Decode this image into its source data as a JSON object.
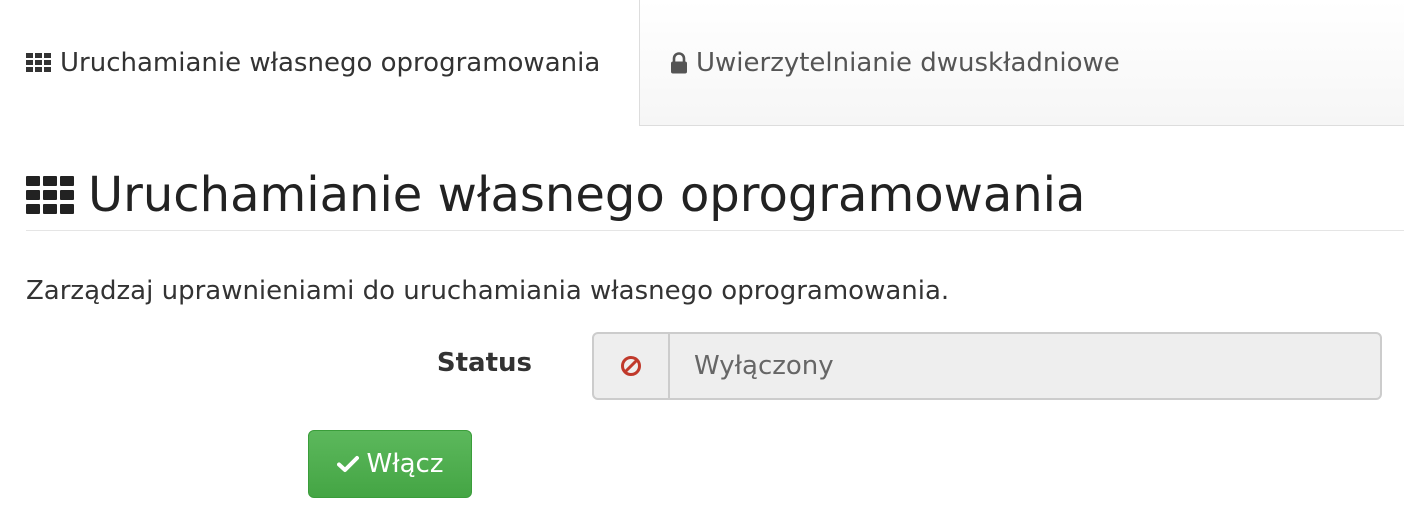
{
  "tabs": [
    {
      "label": "Uruchamianie własnego oprogramowania",
      "icon": "grid-icon",
      "active": true
    },
    {
      "label": "Uwierzytelnianie dwuskładniowe",
      "icon": "lock-icon",
      "active": false
    }
  ],
  "page": {
    "title": "Uruchamianie własnego oprogramowania",
    "title_icon": "grid-icon",
    "description": "Zarządzaj uprawnieniami do uruchamiania własnego oprogramowania."
  },
  "status": {
    "label": "Status",
    "value": "Wyłączony",
    "icon": "ban-icon",
    "icon_color": "#c0392b"
  },
  "actions": {
    "enable_label": "Włącz",
    "enable_icon": "check-icon",
    "enable_color": "#5cb85c"
  }
}
